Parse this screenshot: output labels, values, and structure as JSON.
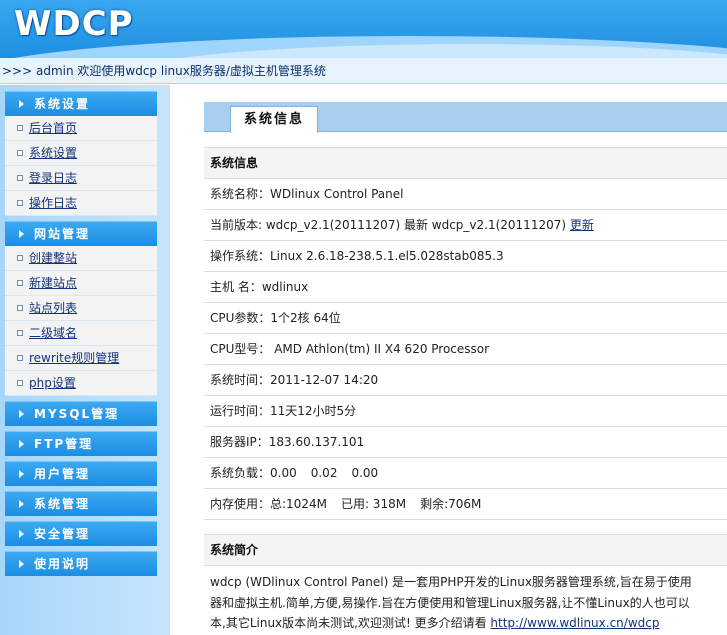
{
  "header": {
    "logo": "WDCP"
  },
  "breadcrumb": ">>> admin 欢迎使用wdcp linux服务器/虚拟主机管理系统",
  "sidebar": {
    "groups": [
      {
        "label": "系统设置",
        "items": [
          "后台首页",
          "系统设置",
          "登录日志",
          "操作日志"
        ]
      },
      {
        "label": "网站管理",
        "items": [
          "创建整站",
          "新建站点",
          "站点列表",
          "二级域名",
          "rewrite规则管理",
          "php设置"
        ]
      },
      {
        "label": "MYSQL管理"
      },
      {
        "label": "FTP管理"
      },
      {
        "label": "用户管理"
      },
      {
        "label": "系统管理"
      },
      {
        "label": "安全管理"
      },
      {
        "label": "使用说明"
      }
    ]
  },
  "main": {
    "tab": "系统信息",
    "info": {
      "header": "系统信息",
      "name": "系统名称：WDlinux Control Panel",
      "version": "当前版本: wdcp_v2.1(20111207) 最新 wdcp_v2.1(20111207)",
      "update_link": "更新",
      "os": "操作系统：Linux 2.6.18-238.5.1.el5.028stab085.3",
      "host": "主机 名：wdlinux",
      "cpu_params": "CPU参数：1个2核 64位",
      "cpu_model": "CPU型号： AMD Athlon(tm) II X4 620 Processor",
      "time": "系统时间：2011-12-07 14:20",
      "uptime": "运行时间：11天12小时5分",
      "ip": "服务器IP：183.60.137.101",
      "load_label": "系统负载：",
      "load": [
        "0.00",
        "0.02",
        "0.00"
      ],
      "mem_label": "内存使用：",
      "mem_total": "总:1024M",
      "mem_used": "已用: 318M",
      "mem_free": "剩余:706M"
    },
    "intro": {
      "header": "系统简介",
      "line1": "wdcp (WDlinux Control Panel) 是一套用PHP开发的Linux服务器管理系统,旨在易于使用",
      "line2": "器和虚拟主机.简单,方便,易操作.旨在方便使用和管理Linux服务器,让不懂Linux的人也可以",
      "line3": "本,其它Linux版本尚未测试,欢迎测试! 更多介绍请看",
      "link": "http://www.wdlinux.cn/wdcp"
    }
  }
}
